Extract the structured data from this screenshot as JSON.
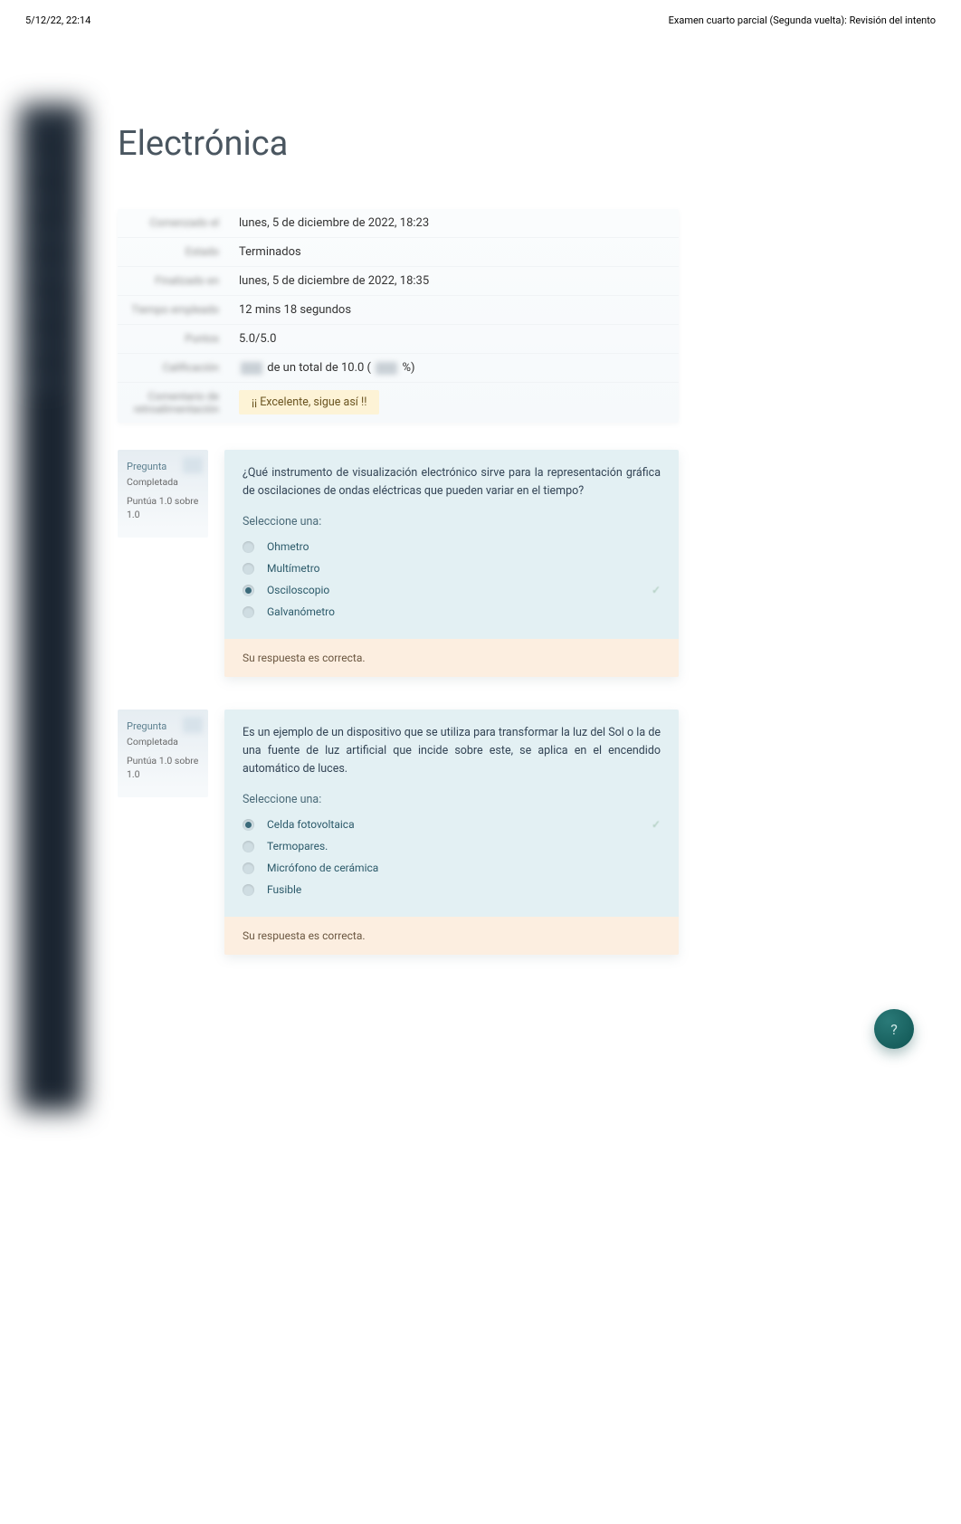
{
  "print_header": {
    "left": "5/12/22, 22:14",
    "right": "Examen cuarto parcial (Segunda vuelta): Revisión del intento"
  },
  "breadcrumb": {
    "a": "",
    "b": "",
    "c": ""
  },
  "page_title": "Electrónica",
  "summary": {
    "rows": [
      {
        "label": "Comenzado el",
        "value": "lunes, 5 de diciembre de 2022, 18:23"
      },
      {
        "label": "Estado",
        "value": "Terminados"
      },
      {
        "label": "Finalizado en",
        "value": "lunes, 5 de diciembre de 2022, 18:35"
      },
      {
        "label": "Tiempo empleado",
        "value": "12 mins 18 segundos"
      },
      {
        "label": "Puntos",
        "value": "5.0/5.0"
      }
    ],
    "grade_label": "Calificación",
    "grade_mid": " de un total de 10.0 (",
    "grade_end": "%)",
    "feedback_label": "Comentario de retroalimentación",
    "feedback_text": "¡¡ Excelente, sigue así !!"
  },
  "questions": [
    {
      "label": "Pregunta",
      "status": "Completada",
      "score": "Puntúa 1.0 sobre 1.0",
      "text": "¿Qué instrumento de visualización electrónico sirve para la representación gráfica de oscilaciones de ondas eléctricas que pueden variar en el tiempo?",
      "prompt": "Seleccione una:",
      "options": [
        {
          "text": "Ohmetro",
          "selected": false
        },
        {
          "text": "Multímetro",
          "selected": false
        },
        {
          "text": "Osciloscopio",
          "selected": true
        },
        {
          "text": "Galvanómetro",
          "selected": false
        }
      ],
      "feedback": "Su respuesta es correcta."
    },
    {
      "label": "Pregunta",
      "status": "Completada",
      "score": "Puntúa 1.0 sobre 1.0",
      "text": "Es un ejemplo de un dispositivo que se utiliza para transformar la luz del Sol o la de una fuente de luz artificial que incide sobre este, se aplica en el encendido automático de luces.",
      "prompt": "Seleccione una:",
      "options": [
        {
          "text": "Celda fotovoltaica",
          "selected": true
        },
        {
          "text": "Termopares.",
          "selected": false
        },
        {
          "text": "Micrófono de cerámica",
          "selected": false
        },
        {
          "text": "Fusible",
          "selected": false
        }
      ],
      "feedback": "Su respuesta es correcta."
    }
  ],
  "chat_icon": "?"
}
